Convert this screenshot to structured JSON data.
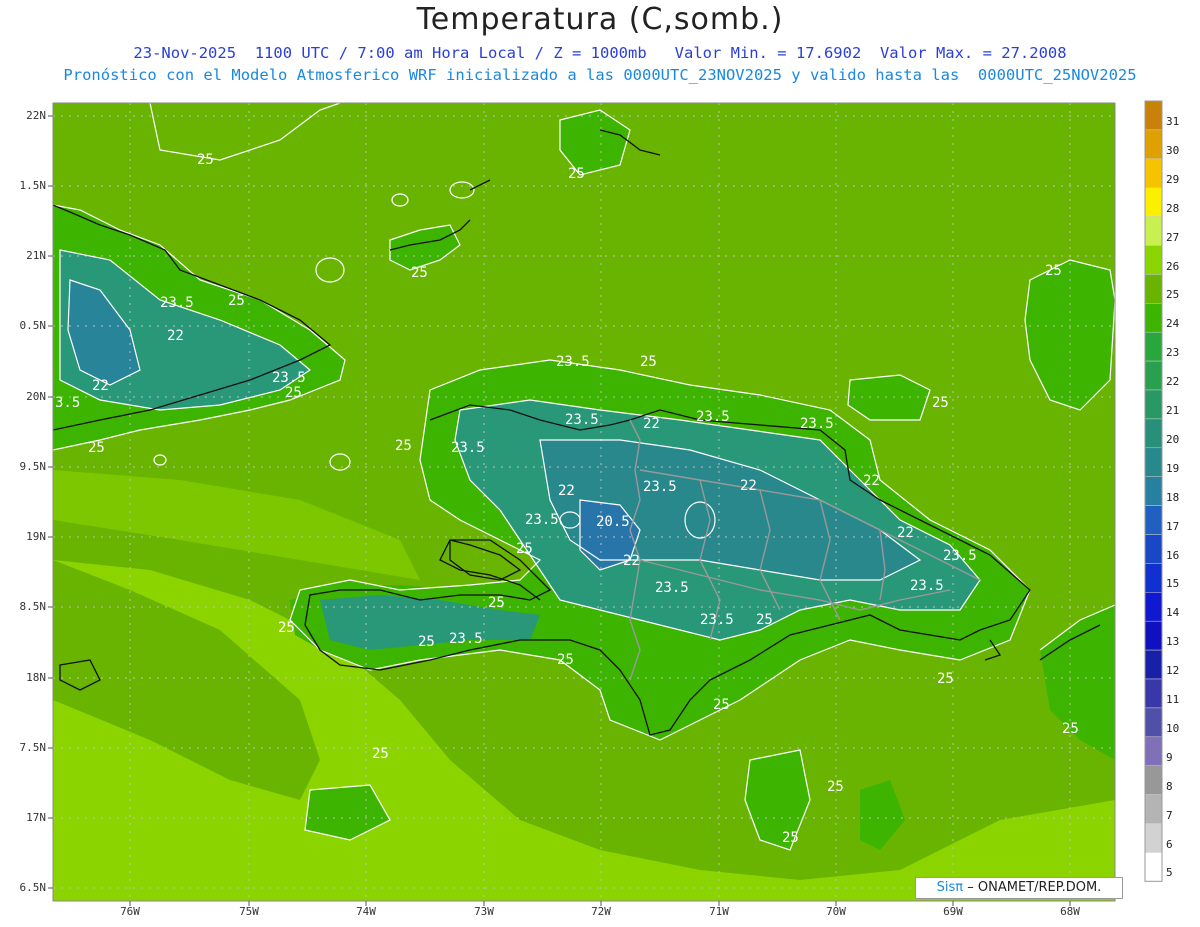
{
  "header": {
    "title": "Temperatura (C,somb.)",
    "subtitle_line1": "23-Nov-2025  1100 UTC / 7:00 am Hora Local / Z = 1000mb   Valor Min. = 17.6902  Valor Max. = 27.2008",
    "subtitle_line2": "Pronóstico con el Modelo Atmosferico WRF inicializado a las 0000UTC_23NOV2025 y valido hasta las  0000UTC_25NOV2025"
  },
  "axes": {
    "lat_labels": [
      "22N",
      "1.5N",
      "21N",
      "0.5N",
      "20N",
      "9.5N",
      "19N",
      "8.5N",
      "18N",
      "7.5N",
      "17N",
      "6.5N"
    ],
    "lon_labels": [
      "76W",
      "75W",
      "74W",
      "73W",
      "72W",
      "71W",
      "70W",
      "69W",
      "68W"
    ]
  },
  "contour_labels": [
    "25",
    "25",
    "25",
    "25",
    "23.5",
    "25",
    "22",
    "23.5",
    "22",
    "3.5",
    "25",
    "25",
    "23.5",
    "25",
    "22",
    "23.5",
    "25",
    "23.5",
    "22",
    "23.5",
    "25",
    "23.5",
    "22",
    "23.5",
    "22",
    "22",
    "20.5",
    "25",
    "23.5",
    "22",
    "23.5",
    "23.5",
    "25",
    "25",
    "25",
    "23.5",
    "25",
    "23.5",
    "23.5",
    "25",
    "25",
    "25",
    "25",
    "25",
    "25",
    "25"
  ],
  "colorbar": {
    "labels": [
      "31",
      "30",
      "29",
      "28",
      "27",
      "26",
      "25",
      "24",
      "23",
      "22",
      "21",
      "20",
      "19",
      "18",
      "17",
      "16",
      "15",
      "14",
      "13",
      "12",
      "11",
      "10",
      "9",
      "8",
      "7",
      "6",
      "5"
    ],
    "colors": [
      "#c8820a",
      "#e0a000",
      "#f7c200",
      "#fbf000",
      "#c8f050",
      "#8cd400",
      "#68b400",
      "#3cb400",
      "#28a83c",
      "#28a050",
      "#289864",
      "#289078",
      "#28888c",
      "#2880a0",
      "#2060c0",
      "#1848c8",
      "#1030d0",
      "#1018d0",
      "#1010c0",
      "#1820a8",
      "#3838a8",
      "#5050a8",
      "#8070b8",
      "#989898",
      "#b4b4b4",
      "#d2d2d2",
      "#ffffff"
    ]
  },
  "credit": {
    "brand": "Sisπ",
    "text": "– ONAMET/REP.DOM."
  },
  "colors": {
    "sea_light": "#8cd400",
    "sea_mid": "#68b400",
    "land_warm": "#3cb400",
    "land_cool": "#28a050",
    "highland": "#289878",
    "peak": "#2880a0",
    "coast": "#111111",
    "border": "#999999",
    "contour": "#ffffff"
  }
}
